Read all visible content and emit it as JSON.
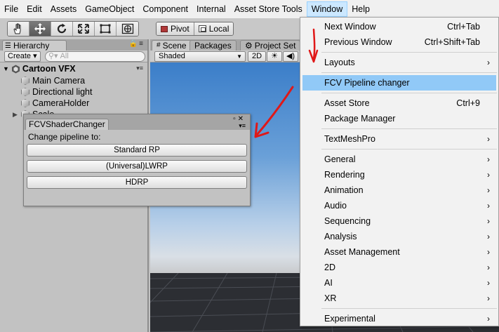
{
  "menubar": {
    "items": [
      "File",
      "Edit",
      "Assets",
      "GameObject",
      "Component",
      "Internal",
      "Asset Store Tools",
      "Window",
      "Help"
    ],
    "active": "Window"
  },
  "toolbar": {
    "tools": [
      "hand-tool-icon",
      "move-tool-icon",
      "rotate-tool-icon",
      "scale-tool-icon",
      "rect-tool-icon",
      "transform-tool-icon"
    ],
    "pivot_label": "Pivot",
    "local_label": "Local"
  },
  "hierarchy": {
    "tab_label": "Hierarchy",
    "create_label": "Create",
    "search_placeholder": "All",
    "scene_name": "Cartoon VFX",
    "items": [
      "Main Camera",
      "Directional light",
      "CameraHolder",
      "Scale"
    ]
  },
  "scene": {
    "tabs": [
      "Scene",
      "Packages",
      "Project Set"
    ],
    "shading": "Shaded",
    "mode_2d": "2D"
  },
  "fcv_window": {
    "tab_title": "FCVShaderChanger",
    "prompt": "Change pipeline to:",
    "buttons": [
      "Standard RP",
      "(Universal)LWRP",
      "HDRP"
    ]
  },
  "window_menu": {
    "items": [
      {
        "label": "Next Window",
        "shortcut": "Ctrl+Tab"
      },
      {
        "label": "Previous Window",
        "shortcut": "Ctrl+Shift+Tab"
      },
      {
        "label": "Layouts",
        "shortcut": ""
      },
      {
        "label": "FCV Pipeline changer",
        "shortcut": ""
      },
      {
        "label": "Asset Store",
        "shortcut": "Ctrl+9"
      },
      {
        "label": "Package Manager",
        "shortcut": ""
      },
      {
        "label": "TextMeshPro",
        "shortcut": ""
      },
      {
        "label": "General",
        "shortcut": ""
      },
      {
        "label": "Rendering",
        "shortcut": ""
      },
      {
        "label": "Animation",
        "shortcut": ""
      },
      {
        "label": "Audio",
        "shortcut": ""
      },
      {
        "label": "Sequencing",
        "shortcut": ""
      },
      {
        "label": "Analysis",
        "shortcut": ""
      },
      {
        "label": "Asset Management",
        "shortcut": ""
      },
      {
        "label": "2D",
        "shortcut": ""
      },
      {
        "label": "AI",
        "shortcut": ""
      },
      {
        "label": "XR",
        "shortcut": ""
      },
      {
        "label": "Experimental",
        "shortcut": ""
      }
    ],
    "highlighted": "FCV Pipeline changer"
  },
  "colors": {
    "menu_highlight": "#91c9f7",
    "annotation_arrow": "#e01818"
  }
}
